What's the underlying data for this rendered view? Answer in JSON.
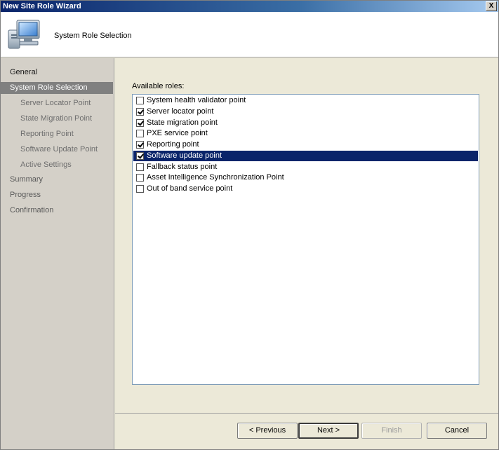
{
  "window": {
    "title": "New Site Role Wizard",
    "close_glyph": "X"
  },
  "header": {
    "title": "System Role Selection",
    "icon": "computer-monitor-icon"
  },
  "nav": {
    "items": [
      {
        "label": "General",
        "level": 0,
        "state": "normal"
      },
      {
        "label": "System Role Selection",
        "level": 0,
        "state": "active"
      },
      {
        "label": "Server Locator Point",
        "level": 1,
        "state": "normal"
      },
      {
        "label": "State Migration Point",
        "level": 1,
        "state": "normal"
      },
      {
        "label": "Reporting Point",
        "level": 1,
        "state": "normal"
      },
      {
        "label": "Software Update Point",
        "level": 1,
        "state": "normal"
      },
      {
        "label": "Active Settings",
        "level": 1,
        "state": "normal"
      },
      {
        "label": "Summary",
        "level": 0,
        "state": "normal"
      },
      {
        "label": "Progress",
        "level": 0,
        "state": "normal"
      },
      {
        "label": "Confirmation",
        "level": 0,
        "state": "normal"
      }
    ]
  },
  "main": {
    "roles_label": "Available roles:",
    "roles": [
      {
        "label": "System health validator point",
        "checked": false,
        "selected": false
      },
      {
        "label": "Server locator point",
        "checked": true,
        "selected": false
      },
      {
        "label": "State migration point",
        "checked": true,
        "selected": false
      },
      {
        "label": "PXE service point",
        "checked": false,
        "selected": false
      },
      {
        "label": "Reporting point",
        "checked": true,
        "selected": false
      },
      {
        "label": "Software update point",
        "checked": true,
        "selected": true
      },
      {
        "label": "Fallback status point",
        "checked": false,
        "selected": false
      },
      {
        "label": "Asset Intelligence Synchronization Point",
        "checked": false,
        "selected": false
      },
      {
        "label": "Out of band service point",
        "checked": false,
        "selected": false
      }
    ]
  },
  "buttons": {
    "previous": "< Previous",
    "next": "Next >",
    "finish": "Finish",
    "cancel": "Cancel"
  },
  "colors": {
    "selection": "#0a246a",
    "nav_active": "#808080"
  }
}
